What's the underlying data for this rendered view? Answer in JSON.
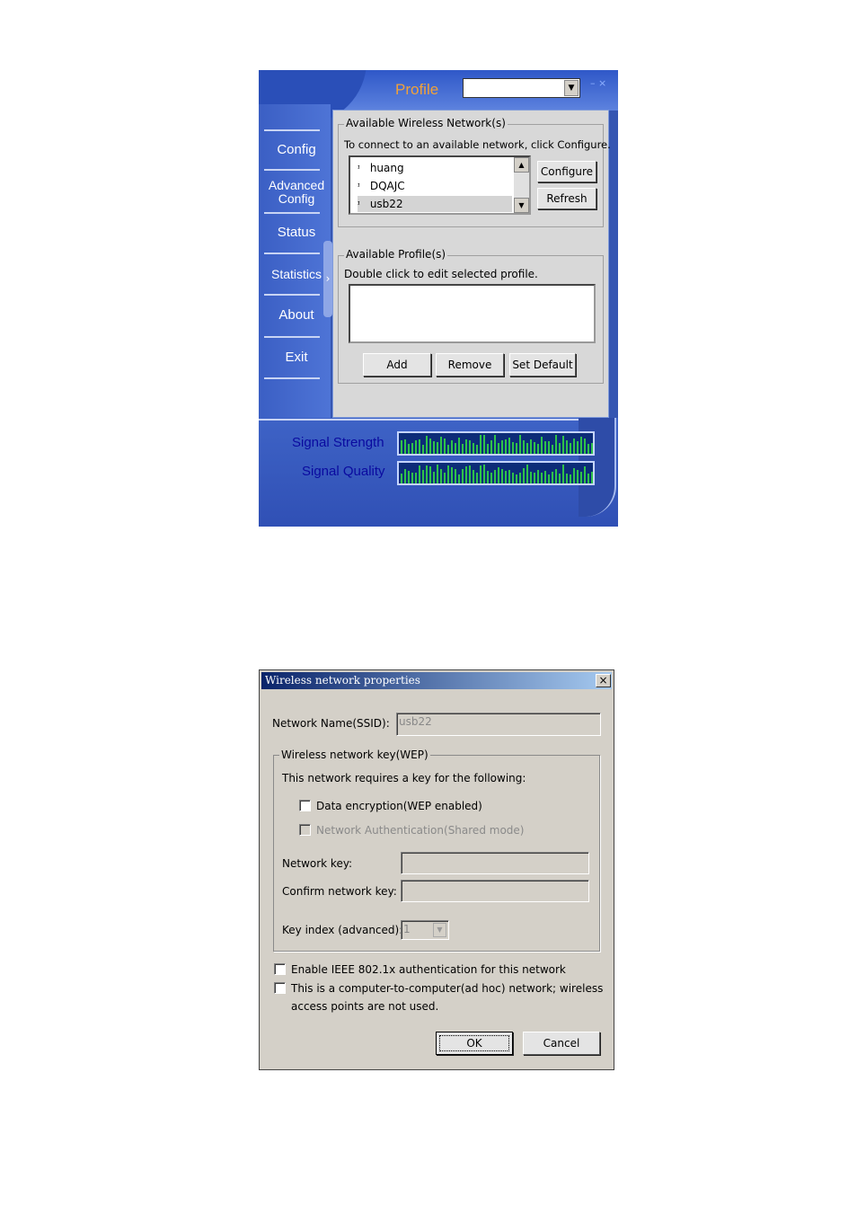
{
  "utility": {
    "header": {
      "title": "Profile",
      "profile_select": "",
      "minimize": "–",
      "close": "×"
    },
    "sidebar": {
      "items": [
        {
          "label": "Config"
        },
        {
          "label": "Advanced",
          "label2": "Config"
        },
        {
          "label": "Status"
        },
        {
          "label": "Statistics"
        },
        {
          "label": "About"
        },
        {
          "label": "Exit"
        }
      ],
      "collapse_arrow": "›"
    },
    "networks": {
      "group_title": "Available Wireless Network(s)",
      "instruction": "To connect to an available network, click Configure.",
      "items": [
        "huang",
        "DQAJC",
        "usb22"
      ],
      "selected": "usb22",
      "configure_button": "Configure",
      "refresh_button": "Refresh"
    },
    "profiles": {
      "group_title": "Available Profile(s)",
      "instruction": "Double click to edit selected profile.",
      "items": [],
      "add_button": "Add",
      "remove_button": "Remove",
      "set_default_button": "Set Default"
    },
    "meters": {
      "signal_strength_label": "Signal Strength",
      "signal_quality_label": "Signal Quality"
    },
    "colors": {
      "meter_bar": "#2fc24a",
      "meter_bg": "#0d2c78",
      "title_accent": "#f0a23a"
    }
  },
  "dialog": {
    "title": "Wireless network properties",
    "close": "×",
    "ssid_label": "Network Name(SSID):",
    "ssid_value": "usb22",
    "wep_group_title": "Wireless network key(WEP)",
    "wep_instruction": "This network requires a key for the following:",
    "data_encryption_label": "Data encryption(WEP enabled)",
    "data_encryption_checked": false,
    "network_auth_label": "Network Authentication(Shared mode)",
    "network_auth_checked": false,
    "network_key_label": "Network key:",
    "network_key_value": "",
    "confirm_key_label": "Confirm network key:",
    "confirm_key_value": "",
    "key_index_label": "Key index (advanced):",
    "key_index_value": "1",
    "ieee_label": "Enable IEEE 802.1x authentication for this network",
    "ieee_checked": false,
    "adhoc_label_line1": "This is a computer-to-computer(ad hoc) network; wireless",
    "adhoc_label_line2": "access points are not used.",
    "adhoc_checked": false,
    "ok_button": "OK",
    "cancel_button": "Cancel"
  }
}
